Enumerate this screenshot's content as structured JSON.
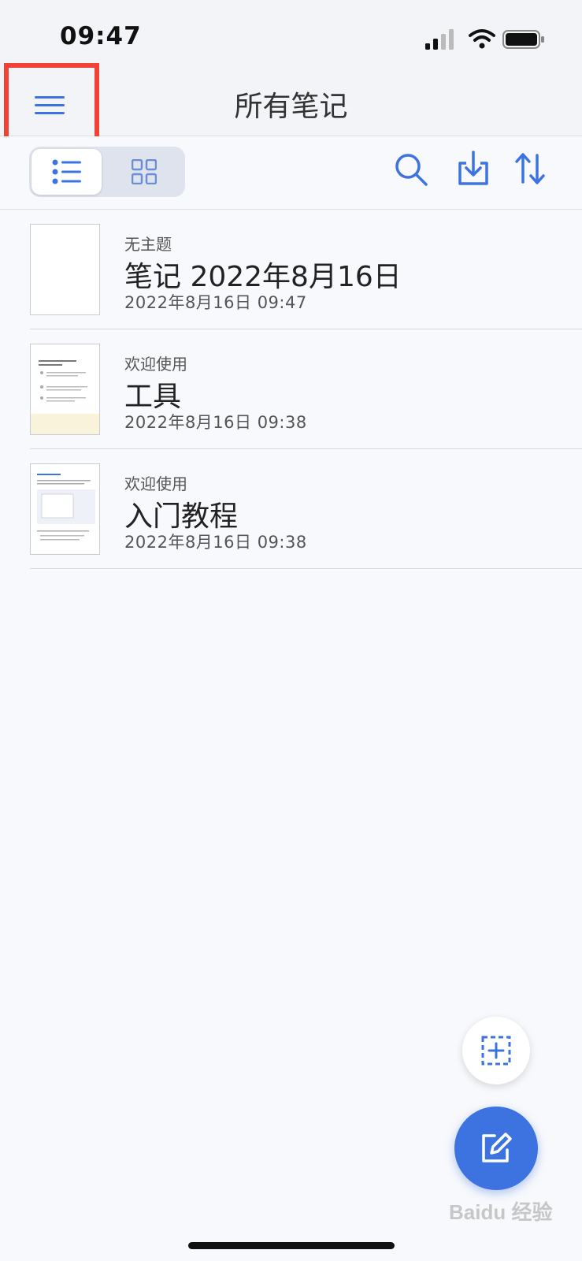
{
  "status_bar": {
    "time": "09:47"
  },
  "header": {
    "title": "所有笔记"
  },
  "notes": [
    {
      "subtitle": "无主题",
      "title": "笔记 2022年8月16日",
      "date": "2022年8月16日 09:47"
    },
    {
      "subtitle": "欢迎使用",
      "title": "工具",
      "date": "2022年8月16日 09:38"
    },
    {
      "subtitle": "欢迎使用",
      "title": "入门教程",
      "date": "2022年8月16日 09:38"
    }
  ],
  "watermark": "Baidu 经验",
  "colors": {
    "accent": "#3d73e0",
    "highlight_box": "#f24236",
    "background": "#f8f9fc"
  },
  "icons": [
    "menu-icon",
    "list-view-icon",
    "grid-view-icon",
    "search-icon",
    "import-icon",
    "sort-icon",
    "add-page-icon",
    "edit-icon"
  ]
}
